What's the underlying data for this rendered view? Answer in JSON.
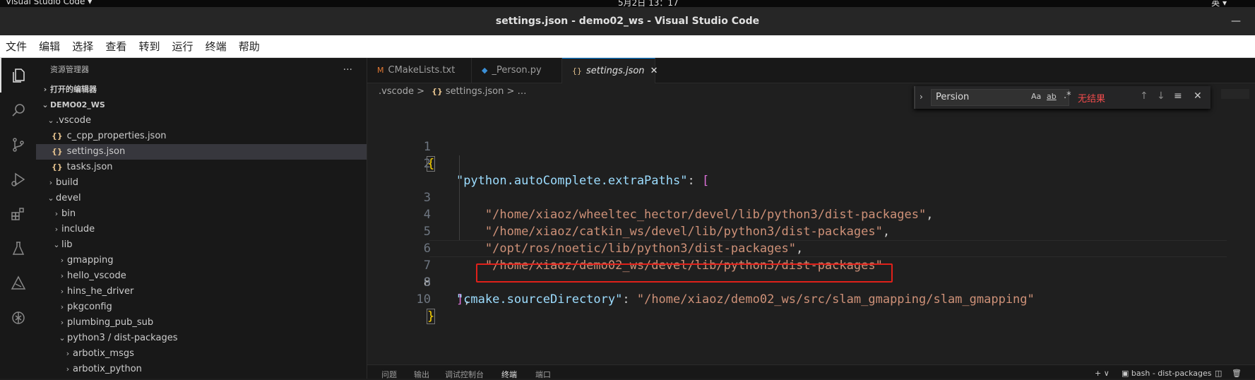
{
  "system": {
    "app": "Visual Studio Code ▾",
    "clock": "5月2日 13：17",
    "lang": "英 ▾"
  },
  "window": {
    "title": "settings.json - demo02_ws - Visual Studio Code",
    "minimize": "—"
  },
  "menu": [
    "文件",
    "编辑",
    "选择",
    "查看",
    "转到",
    "运行",
    "终端",
    "帮助"
  ],
  "sidebar": {
    "title": "资源管理器",
    "more": "···",
    "open_editors": "打开的编辑器",
    "workspace": "DEMO02_WS",
    "tree": [
      {
        "label": ".vscode",
        "indent": 1,
        "kind": "folder-open"
      },
      {
        "label": "c_cpp_properties.json",
        "indent": 2,
        "kind": "json"
      },
      {
        "label": "settings.json",
        "indent": 2,
        "kind": "json",
        "selected": true
      },
      {
        "label": "tasks.json",
        "indent": 2,
        "kind": "json"
      },
      {
        "label": "build",
        "indent": 1,
        "kind": "folder"
      },
      {
        "label": "devel",
        "indent": 1,
        "kind": "folder-open"
      },
      {
        "label": "bin",
        "indent": 2,
        "kind": "folder"
      },
      {
        "label": "include",
        "indent": 2,
        "kind": "folder"
      },
      {
        "label": "lib",
        "indent": 2,
        "kind": "folder-open"
      },
      {
        "label": "gmapping",
        "indent": 3,
        "kind": "folder"
      },
      {
        "label": "hello_vscode",
        "indent": 3,
        "kind": "folder"
      },
      {
        "label": "hins_he_driver",
        "indent": 3,
        "kind": "folder"
      },
      {
        "label": "pkgconfig",
        "indent": 3,
        "kind": "folder"
      },
      {
        "label": "plumbing_pub_sub",
        "indent": 3,
        "kind": "folder"
      },
      {
        "label": "python3 / dist-packages",
        "indent": 3,
        "kind": "folder-open"
      },
      {
        "label": "arbotix_msgs",
        "indent": 4,
        "kind": "folder"
      },
      {
        "label": "arbotix_python",
        "indent": 4,
        "kind": "folder"
      }
    ]
  },
  "tabs": [
    {
      "label": "CMakeLists.txt",
      "icon": "M",
      "active": false
    },
    {
      "label": "_Person.py",
      "icon": "◆",
      "active": false
    },
    {
      "label": "settings.json",
      "icon": "{}",
      "active": true,
      "close": "✕"
    }
  ],
  "breadcrumb": {
    "folder": ".vscode",
    "sep": ">",
    "file": "settings.json",
    "tail": "> …"
  },
  "find": {
    "value": "Persion",
    "match_case": "Aa",
    "whole_word": "ab",
    "regex": ".*",
    "result": "无结果",
    "prev": "↑",
    "next": "↓",
    "menu": "≡",
    "close": "✕"
  },
  "code": {
    "line_numbers": [
      "1",
      "2",
      "3",
      "4",
      "5",
      "6",
      "7",
      "8",
      "9",
      "10"
    ],
    "l1_open": "{",
    "l2_key": "\"python.autoComplete.extraPaths\"",
    "l2_colon": ": ",
    "l2_bracket": "[",
    "l3": "\"/home/xiaoz/wheeltec_hector/devel/lib/python3/dist-packages\"",
    "l4": "\"/home/xiaoz/catkin_ws/devel/lib/python3/dist-packages\"",
    "l5": "\"/opt/ros/noetic/lib/python3/dist-packages\"",
    "l6": "\"/home/xiaoz/demo02_ws/devel/lib/python3/dist-packages\"",
    "comma": ",",
    "l8_bracket": "]",
    "l9_key": "\"cmake.sourceDirectory\"",
    "l9_value": "\"/home/xiaoz/demo02_ws/src/slam_gmapping/slam_gmapping\"",
    "l10_close": "}"
  },
  "panel": {
    "tabs": [
      "问题",
      "输出",
      "调试控制台",
      "终端",
      "端口"
    ],
    "active": "终端",
    "plus": "+ ∨",
    "terminal": "bash - dist-packages",
    "split": "◫",
    "trash": "🗑"
  },
  "colors": {
    "accent": "#0078d4",
    "annotation": "#e0201a"
  }
}
